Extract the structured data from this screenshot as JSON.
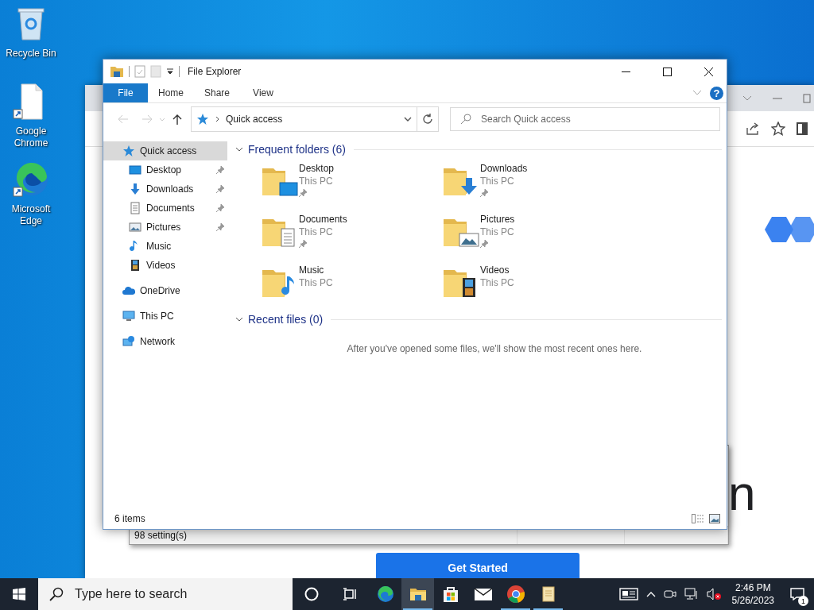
{
  "desktop_icons": [
    {
      "label": "Recycle Bin",
      "kind": "recycle"
    },
    {
      "label": "Google Chrome",
      "kind": "file"
    },
    {
      "label": "Microsoft Edge",
      "kind": "edge"
    }
  ],
  "browser_window": {
    "heading_fragment": "n",
    "button": "Get Started"
  },
  "settings_window": {
    "status": "98 setting(s)"
  },
  "explorer": {
    "title": "File Explorer",
    "ribbon_tabs": [
      {
        "label": "File",
        "selected": true
      },
      {
        "label": "Home",
        "selected": false
      },
      {
        "label": "Share",
        "selected": false
      },
      {
        "label": "View",
        "selected": false
      }
    ],
    "help_label": "?",
    "address": "Quick access",
    "search": {
      "placeholder": "Search Quick access"
    },
    "nav": [
      {
        "label": "Quick access",
        "kind": "quick",
        "selected": true,
        "children": [
          {
            "label": "Desktop",
            "kind": "desktop",
            "pinned": true,
            "selected": false
          },
          {
            "label": "Downloads",
            "kind": "downloads",
            "pinned": true,
            "selected": false
          },
          {
            "label": "Documents",
            "kind": "documents",
            "pinned": true,
            "selected": false
          },
          {
            "label": "Pictures",
            "kind": "pictures",
            "pinned": true,
            "selected": false
          },
          {
            "label": "Music",
            "kind": "music",
            "pinned": false,
            "selected": false
          },
          {
            "label": "Videos",
            "kind": "videos",
            "pinned": false,
            "selected": false
          }
        ]
      },
      {
        "label": "OneDrive",
        "kind": "onedrive",
        "selected": false
      },
      {
        "label": "This PC",
        "kind": "thispc",
        "selected": false
      },
      {
        "label": "Network",
        "kind": "network",
        "selected": false
      }
    ],
    "sections": [
      {
        "title": "Frequent folders (6)",
        "expanded": true,
        "folders": [
          {
            "name": "Desktop",
            "location": "This PC",
            "kind": "desktop",
            "pinned": true
          },
          {
            "name": "Downloads",
            "location": "This PC",
            "kind": "downloads",
            "pinned": true
          },
          {
            "name": "Documents",
            "location": "This PC",
            "kind": "documents",
            "pinned": true
          },
          {
            "name": "Pictures",
            "location": "This PC",
            "kind": "pictures",
            "pinned": true
          },
          {
            "name": "Music",
            "location": "This PC",
            "kind": "music",
            "pinned": false
          },
          {
            "name": "Videos",
            "location": "This PC",
            "kind": "videos",
            "pinned": false
          }
        ]
      },
      {
        "title": "Recent files (0)",
        "expanded": true,
        "message": "After you've opened some files, we'll show the most recent ones here."
      }
    ],
    "status_bar": "6 items"
  },
  "taskbar": {
    "search": {
      "placeholder": "Type here to search"
    },
    "apps": [
      {
        "kind": "edge",
        "running": false,
        "selected": false
      },
      {
        "kind": "explorer",
        "running": true,
        "selected": true
      },
      {
        "kind": "store",
        "running": false,
        "selected": false
      },
      {
        "kind": "mail",
        "running": false,
        "selected": false
      },
      {
        "kind": "chrome",
        "running": true,
        "selected": false
      },
      {
        "kind": "notes",
        "running": true,
        "selected": false
      }
    ],
    "time": "2:46 PM",
    "date": "5/26/2023",
    "notification_count": "1"
  }
}
